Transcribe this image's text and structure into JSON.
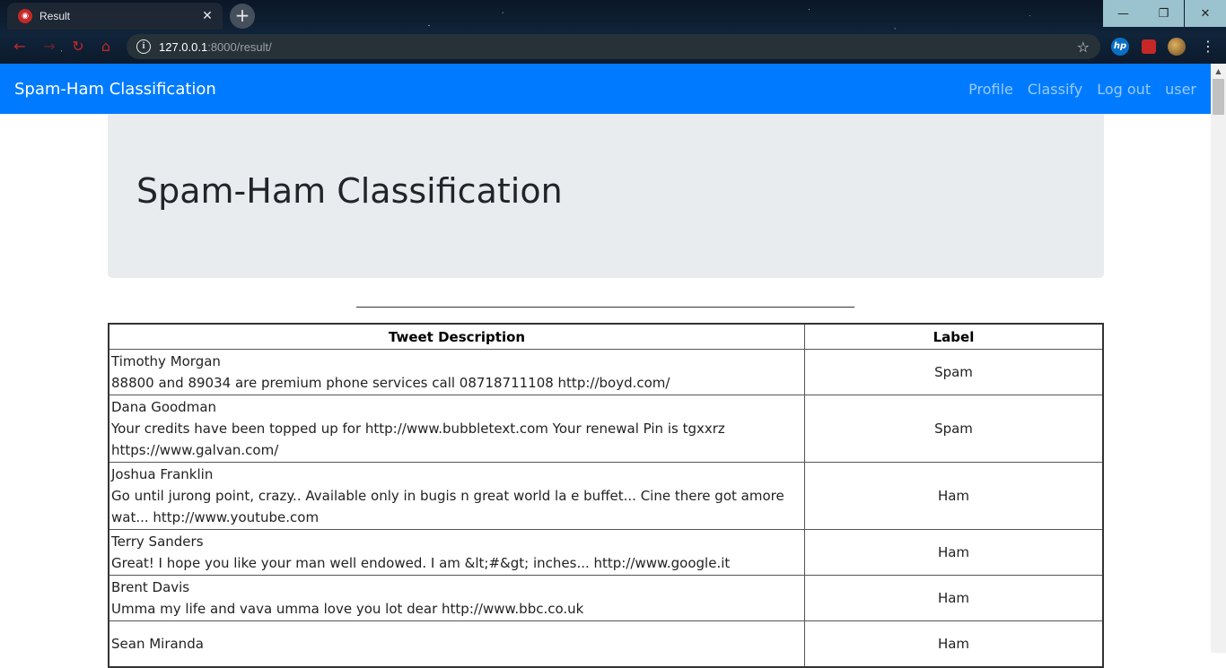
{
  "browser": {
    "tab_title": "Result",
    "favicon": "django-icon",
    "url_host": "127.0.0.1",
    "url_rest": ":8000/result/"
  },
  "navbar": {
    "brand": "Spam-Ham Classification",
    "links": [
      "Profile",
      "Classify",
      "Log out",
      "user"
    ],
    "color": "#007bff"
  },
  "jumbotron": {
    "title": "Spam-Ham Classification"
  },
  "table": {
    "headers": [
      "Tweet Description",
      "Label"
    ],
    "rows": [
      {
        "name": "Timothy Morgan",
        "text": "88800 and 89034 are premium phone services call 08718711108 http://boyd.com/",
        "label": "Spam"
      },
      {
        "name": "Dana Goodman",
        "text": "Your credits have been topped up for http://www.bubbletext.com Your renewal Pin is tgxxrz https://www.galvan.com/",
        "label": "Spam"
      },
      {
        "name": "Joshua Franklin",
        "text": "Go until jurong point, crazy.. Available only in bugis n great world la e buffet... Cine there got amore wat... http://www.youtube.com",
        "label": "Ham"
      },
      {
        "name": "Terry Sanders",
        "text": "Great! I hope you like your man well endowed. I am &lt;#&gt; inches... http://www.google.it",
        "label": "Ham"
      },
      {
        "name": "Brent Davis",
        "text": "Umma my life and vava umma love you lot dear http://www.bbc.co.uk",
        "label": "Ham"
      },
      {
        "name": "Sean Miranda",
        "text": "",
        "label": "Ham"
      }
    ]
  }
}
